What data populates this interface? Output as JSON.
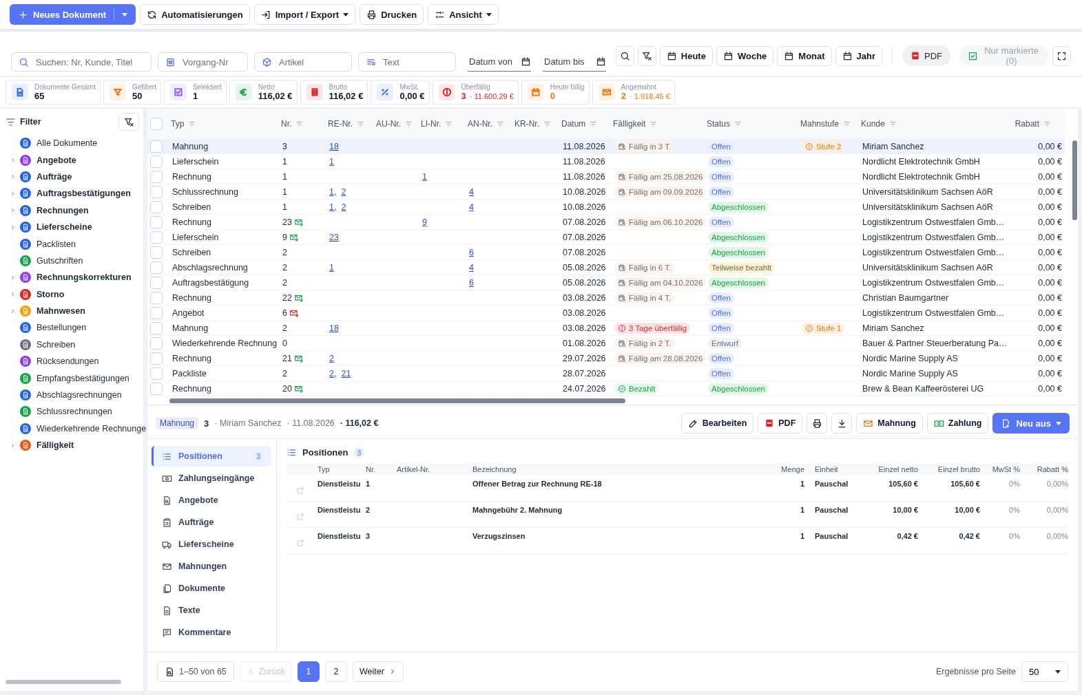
{
  "toolbar": {
    "primary": {
      "label": "Neues Dokument"
    },
    "buttons": [
      {
        "kind": "refresh",
        "label": "Automatisierungen",
        "dropdown": false
      },
      {
        "kind": "import",
        "label": "Import / Export",
        "dropdown": true
      },
      {
        "kind": "print",
        "label": "Drucken",
        "dropdown": false
      },
      {
        "kind": "sliders",
        "label": "Ansicht",
        "dropdown": true
      }
    ]
  },
  "filters": {
    "fields": [
      {
        "kind": "search",
        "placeholder": "Suchen: Nr, Kunde, Titel"
      },
      {
        "kind": "hash",
        "placeholder": "Vorgang-Nr"
      },
      {
        "kind": "cube",
        "placeholder": "Artikel"
      },
      {
        "kind": "text",
        "placeholder": "Text"
      }
    ],
    "dates": [
      {
        "placeholder": "Datum von"
      },
      {
        "placeholder": "Datum bis"
      }
    ],
    "periods": [
      "Heute",
      "Woche",
      "Monat",
      "Jahr"
    ],
    "pdf": "PDF",
    "marked": {
      "label": "Nur markierte (0)",
      "disabled": true
    }
  },
  "stats": [
    {
      "kind": "doc",
      "color": "#3b6ff5",
      "label": "Dokumente Gesamt",
      "value": "65"
    },
    {
      "kind": "filter",
      "color": "#f0760e",
      "label": "Gefiltert",
      "value": "50"
    },
    {
      "kind": "check",
      "color": "#8b5cf6",
      "label": "Selektiert",
      "value": "1"
    },
    {
      "kind": "euro",
      "color": "#16a34a",
      "label": "Netto",
      "value": "116,02 €"
    },
    {
      "kind": "list",
      "color": "#dc2626",
      "label": "Brutto",
      "value": "116,02 €"
    },
    {
      "kind": "percent",
      "color": "#3b6ff5",
      "label": "MwSt.",
      "value": "0,00 €"
    },
    {
      "kind": "alert",
      "color": "#dc2626",
      "label": "Überfällig",
      "value": "3",
      "danger": true,
      "extra": "· 11.600,29 €"
    },
    {
      "kind": "calendar",
      "color": "#f0760e",
      "label": "Heute fällig",
      "value": "0",
      "warning": true
    },
    {
      "kind": "mail",
      "color": "#f0760e",
      "label": "Angemahnt",
      "value": "2",
      "warning": true,
      "extra": "· 1.918,45 €"
    }
  ],
  "sidebar": {
    "title": "Filter",
    "items": [
      {
        "label": "Alle Dokumente",
        "expandable": false,
        "color": "#2563eb"
      },
      {
        "label": "Angebote",
        "expandable": true,
        "color": "#8b3ff0"
      },
      {
        "label": "Aufträge",
        "expandable": true,
        "color": "#2563eb"
      },
      {
        "label": "Auftragsbestätigungen",
        "expandable": true,
        "color": "#2563eb"
      },
      {
        "label": "Rechnungen",
        "expandable": true,
        "color": "#2563eb"
      },
      {
        "label": "Lieferscheine",
        "expandable": true,
        "color": "#2563eb"
      },
      {
        "label": "Packlisten",
        "expandable": false,
        "color": "#2563eb"
      },
      {
        "label": "Gutschriften",
        "expandable": false,
        "color": "#16a34a"
      },
      {
        "label": "Rechnungskorrekturen",
        "expandable": true,
        "color": "#8b3ff0"
      },
      {
        "label": "Storno",
        "expandable": true,
        "color": "#dc2626"
      },
      {
        "label": "Mahnwesen",
        "expandable": true,
        "color": "#f59e0b"
      },
      {
        "label": "Bestellungen",
        "expandable": false,
        "color": "#2563eb"
      },
      {
        "label": "Schreiben",
        "expandable": false,
        "color": "#6b7280"
      },
      {
        "label": "Rücksendungen",
        "expandable": false,
        "color": "#8b3ff0"
      },
      {
        "label": "Empfangsbestätigungen",
        "expandable": false,
        "color": "#16a34a"
      },
      {
        "label": "Abschlagsrechnungen",
        "expandable": false,
        "color": "#2563eb"
      },
      {
        "label": "Schlussrechnungen",
        "expandable": false,
        "color": "#16a34a"
      },
      {
        "label": "Wiederkehrende Rechnunge",
        "expandable": false,
        "color": "#2563eb"
      },
      {
        "label": "Fälligkeit",
        "expandable": true,
        "color": "#ea580c"
      }
    ]
  },
  "table": {
    "select_all": {
      "checked": false
    },
    "columns": [
      "Typ",
      "Nr.",
      "RE-Nr.",
      "AU-Nr.",
      "LI-Nr.",
      "AN-Nr.",
      "KR-Nr.",
      "Datum",
      "Fälligkeit",
      "Status",
      "Mahnstufe",
      "Kunde",
      "Rabatt"
    ],
    "rows": [
      {
        "selected": true,
        "type": "Mahnung",
        "nr": "3",
        "re": [
          "18"
        ],
        "date": "11.08.2026",
        "due": {
          "kind": "pending",
          "text": "Fällig in 3 T."
        },
        "status": {
          "kind": "open",
          "text": "Offen"
        },
        "dunning": "Stufe 2",
        "customer": "Miriam Sanchez",
        "discount": "0,00 €"
      },
      {
        "selected": false,
        "type": "Lieferschein",
        "nr": "1",
        "re": [
          "1"
        ],
        "date": "11.08.2026",
        "status": {
          "kind": "open",
          "text": "Offen"
        },
        "customer": "Nordlicht Elektrotechnik GmbH",
        "discount": "0,00 €"
      },
      {
        "selected": false,
        "type": "Rechnung",
        "nr": "1",
        "li": [
          "1"
        ],
        "date": "11.08.2026",
        "due": {
          "kind": "pending",
          "text": "Fällig am 25.08.2026"
        },
        "status": {
          "kind": "open",
          "text": "Offen"
        },
        "customer": "Nordlicht Elektrotechnik GmbH",
        "discount": "0,00 €"
      },
      {
        "selected": false,
        "type": "Schlussrechnung",
        "nr": "1",
        "re": [
          "1,",
          "2"
        ],
        "an": [
          "4"
        ],
        "date": "10.08.2026",
        "due": {
          "kind": "pending",
          "text": "Fällig am 09.09.2026"
        },
        "status": {
          "kind": "open",
          "text": "Offen"
        },
        "customer": "Universitätsklinikum Sachsen AöR",
        "discount": "0,00 €"
      },
      {
        "selected": false,
        "type": "Schreiben",
        "nr": "1",
        "re": [
          "1,",
          "2"
        ],
        "an": [
          "4"
        ],
        "date": "10.08.2026",
        "status": {
          "kind": "closed",
          "text": "Abgeschlossen"
        },
        "customer": "Universitätsklinikum Sachsen AöR",
        "discount": "0,00 €"
      },
      {
        "selected": false,
        "type": "Rechnung",
        "nr": "23",
        "mail": {
          "kind": "sent"
        },
        "li": [
          "9"
        ],
        "date": "07.08.2026",
        "due": {
          "kind": "pending",
          "text": "Fällig am 06.10.2026"
        },
        "status": {
          "kind": "open",
          "text": "Offen"
        },
        "customer": "Logistikzentrum Ostwestfalen Gmb…",
        "discount": "0,00 €"
      },
      {
        "selected": false,
        "type": "Lieferschein",
        "nr": "9",
        "mail": {
          "kind": "sent"
        },
        "re": [
          "23"
        ],
        "date": "07.08.2026",
        "status": {
          "kind": "closed",
          "text": "Abgeschlossen"
        },
        "customer": "Logistikzentrum Ostwestfalen Gmb…",
        "discount": "0,00 €"
      },
      {
        "selected": false,
        "type": "Schreiben",
        "nr": "2",
        "an": [
          "6"
        ],
        "date": "07.08.2026",
        "status": {
          "kind": "closed",
          "text": "Abgeschlossen"
        },
        "customer": "Logistikzentrum Ostwestfalen Gmb…",
        "discount": "0,00 €"
      },
      {
        "selected": false,
        "type": "Abschlagsrechnung",
        "nr": "2",
        "re": [
          "1"
        ],
        "an": [
          "4"
        ],
        "date": "05.08.2026",
        "due": {
          "kind": "pending",
          "text": "Fällig in 6 T."
        },
        "status": {
          "kind": "partial",
          "text": "Teilweise bezahlt"
        },
        "customer": "Universitätsklinikum Sachsen AöR",
        "discount": "0,00 €"
      },
      {
        "selected": false,
        "type": "Auftragsbestätigung",
        "nr": "2",
        "an": [
          "6"
        ],
        "date": "05.08.2026",
        "due": {
          "kind": "pending",
          "text": "Fällig am 04.10.2026"
        },
        "status": {
          "kind": "closed",
          "text": "Abgeschlossen"
        },
        "customer": "Logistikzentrum Ostwestfalen Gmb…",
        "discount": "0,00 €"
      },
      {
        "selected": false,
        "type": "Rechnung",
        "nr": "22",
        "mail": {
          "kind": "sent"
        },
        "date": "03.08.2026",
        "due": {
          "kind": "pending",
          "text": "Fällig in 4 T."
        },
        "status": {
          "kind": "open",
          "text": "Offen"
        },
        "customer": "Christian Baumgartner",
        "discount": "0,00 €"
      },
      {
        "selected": false,
        "type": "Angebot",
        "nr": "6",
        "mail": {
          "kind": "failed"
        },
        "date": "03.08.2026",
        "status": {
          "kind": "open",
          "text": "Offen"
        },
        "customer": "Logistikzentrum Ostwestfalen Gmb…",
        "discount": "0,00 €"
      },
      {
        "selected": false,
        "type": "Mahnung",
        "nr": "2",
        "re": [
          "18"
        ],
        "date": "03.08.2026",
        "due": {
          "kind": "overdue",
          "text": "3 Tage überfällig"
        },
        "status": {
          "kind": "open",
          "text": "Offen"
        },
        "dunning": "Stufe 1",
        "customer": "Miriam Sanchez",
        "discount": "0,00 €"
      },
      {
        "selected": false,
        "type": "Wiederkehrende Rechnung",
        "nr": "0",
        "date": "01.08.2026",
        "due": {
          "kind": "pending",
          "text": "Fällig in 2 T."
        },
        "status": {
          "kind": "draft",
          "text": "Entwurf"
        },
        "customer": "Bauer & Partner Steuerberatung Pa…",
        "discount": "0,00 €"
      },
      {
        "selected": false,
        "type": "Rechnung",
        "nr": "21",
        "mail": {
          "kind": "sent"
        },
        "re": [
          "2"
        ],
        "date": "29.07.2026",
        "due": {
          "kind": "pending",
          "text": "Fällig am 28.08.2026"
        },
        "status": {
          "kind": "open",
          "text": "Offen"
        },
        "customer": "Nordic Marine Supply AS",
        "discount": "0,00 €"
      },
      {
        "selected": false,
        "type": "Packliste",
        "nr": "2",
        "re": [
          "2,",
          "21"
        ],
        "date": "28.07.2026",
        "status": {
          "kind": "open",
          "text": "Offen"
        },
        "customer": "Nordic Marine Supply AS",
        "discount": "0,00 €"
      },
      {
        "selected": false,
        "type": "Rechnung",
        "nr": "20",
        "mail": {
          "kind": "sent"
        },
        "date": "24.07.2026",
        "due": {
          "kind": "paid",
          "text": "Bezahlt"
        },
        "status": {
          "kind": "closed",
          "text": "Abgeschlossen"
        },
        "customer": "Brew & Bean Kaffeerösterei UG",
        "discount": "0,00 €"
      }
    ]
  },
  "detail": {
    "type": "Mahnung",
    "nr": "3",
    "parts": [
      "· Miriam Sanchez",
      "· 11.08.2026"
    ],
    "total": "· 116,02 €",
    "actions": [
      {
        "kind": "pencil",
        "label": "Bearbeiten"
      },
      {
        "kind": "pdf",
        "label": "PDF"
      },
      {
        "kind": "print"
      },
      {
        "kind": "download"
      },
      {
        "kind": "mail",
        "label": "Mahnung"
      },
      {
        "kind": "cash",
        "label": "Zahlung"
      },
      {
        "kind": "primary",
        "label": "Neu aus"
      }
    ],
    "tabs": [
      {
        "kind": "list",
        "label": "Positionen",
        "count": "3",
        "selected": true
      },
      {
        "kind": "cash",
        "label": "Zahlungseingänge",
        "selected": false
      },
      {
        "kind": "filesearch",
        "label": "Angebote",
        "selected": false
      },
      {
        "kind": "clipboard",
        "label": "Aufträge",
        "selected": false
      },
      {
        "kind": "truck",
        "label": "Lieferscheine",
        "selected": false
      },
      {
        "kind": "mail",
        "label": "Mahnungen",
        "selected": false
      },
      {
        "kind": "docs",
        "label": "Dokumente",
        "selected": false
      },
      {
        "kind": "doc",
        "label": "Texte",
        "selected": false
      },
      {
        "kind": "comment",
        "label": "Kommentare",
        "selected": false
      }
    ],
    "positions": {
      "title": "Positionen",
      "count": "3",
      "columns": [
        "Typ",
        "Nr.",
        "Artikel-Nr.",
        "Bezeichnung",
        "Menge",
        "Einheit",
        "Einzel netto",
        "Einzel brutto",
        "MwSt %",
        "Rabatt %"
      ],
      "rows": [
        {
          "type": "Dienstleistu",
          "nr": "1",
          "name": "Offener Betrag zur Rechnung RE-18",
          "qty": "1",
          "unit": "Pauschal",
          "net": "105,60 €",
          "gross": "105,60 €",
          "vat": "0%",
          "discount": "0,00%"
        },
        {
          "type": "Dienstleistu",
          "nr": "2",
          "name": "Mahngebühr 2. Mahnung",
          "qty": "1",
          "unit": "Pauschal",
          "net": "10,00 €",
          "gross": "10,00 €",
          "vat": "0%",
          "discount": "0,00%"
        },
        {
          "type": "Dienstleistu",
          "nr": "3",
          "name": "Verzugszinsen",
          "qty": "1",
          "unit": "Pauschal",
          "net": "0,42 €",
          "gross": "0,42 €",
          "vat": "0%",
          "discount": "0,00%"
        }
      ]
    }
  },
  "pagination": {
    "range": "1–50 von 65",
    "prev": {
      "label": "Zurück",
      "disabled": true
    },
    "pages": [
      {
        "label": "1",
        "selected": true
      },
      {
        "label": "2",
        "selected": false
      }
    ],
    "next": {
      "label": "Weiter",
      "disabled": false
    },
    "per_page_label": "Ergebnisse pro Seite",
    "per_page": "50"
  }
}
